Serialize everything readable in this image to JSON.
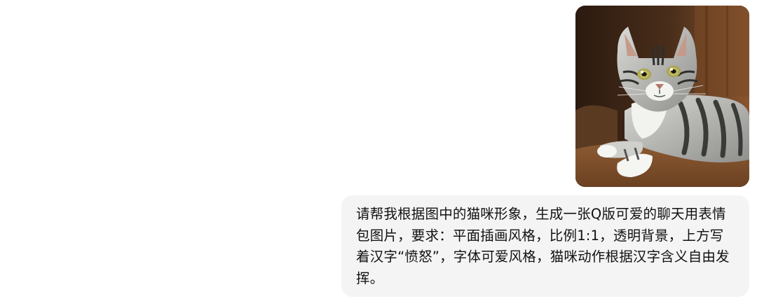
{
  "message": {
    "image": {
      "icon": "photo-cat-icon"
    },
    "text": "请帮我根据图中的猫咪形象，生成一张Q版可爱的聊天用表情包图片，要求：平面插画风格，比例1:1，透明背景，上方写着汉字“愤怒”，字体可爱风格，猫咪动作根据汉字含义自由发挥。"
  }
}
